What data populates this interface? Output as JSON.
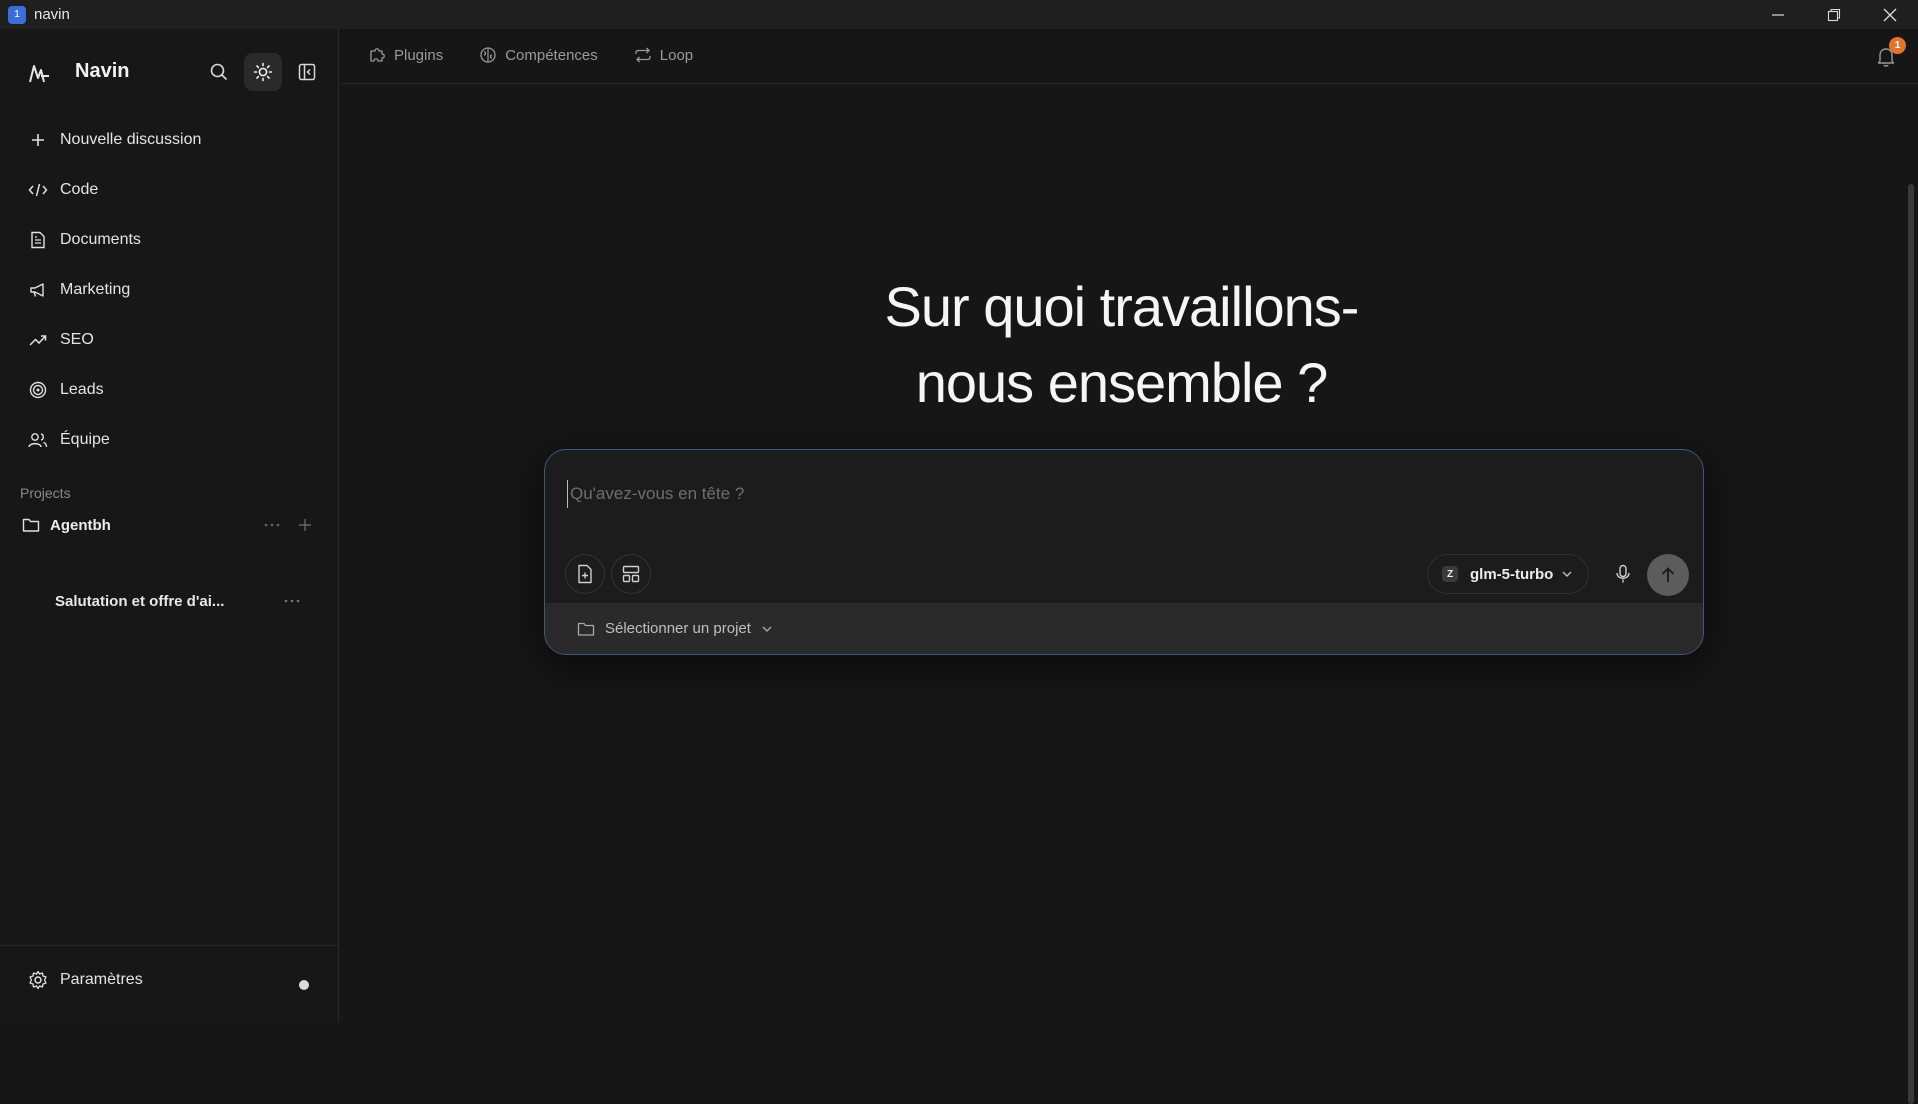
{
  "window": {
    "app_icon_glyph": "1",
    "title": "navin"
  },
  "sidebar": {
    "brand_name": "Navin",
    "nav_items": [
      {
        "label": "Nouvelle discussion",
        "icon": "plus-icon"
      },
      {
        "label": "Code",
        "icon": "code-icon"
      },
      {
        "label": "Documents",
        "icon": "document-icon"
      },
      {
        "label": "Marketing",
        "icon": "megaphone-icon"
      },
      {
        "label": "SEO",
        "icon": "trending-up-icon"
      },
      {
        "label": "Leads",
        "icon": "target-icon"
      },
      {
        "label": "Équipe",
        "icon": "users-icon"
      }
    ],
    "projects_label": "Projects",
    "project_name": "Agentbh",
    "chat_title": "Salutation et offre d'ai...",
    "settings_label": "Paramètres"
  },
  "topnav": {
    "tabs": [
      {
        "label": "Plugins",
        "icon": "puzzle-icon"
      },
      {
        "label": "Compétences",
        "icon": "brain-icon"
      },
      {
        "label": "Loop",
        "icon": "repeat-icon"
      }
    ],
    "notification_count": "1"
  },
  "main": {
    "hero_line1": "Sur quoi travaillons-",
    "hero_line2": "nous ensemble ?",
    "composer": {
      "placeholder": "Qu'avez-vous en tête ?",
      "value": "",
      "model_badge": "Z",
      "model_name": "glm-5-turbo",
      "project_select_label": "Sélectionner un projet"
    }
  },
  "colors": {
    "accent_badge": "#e0742e",
    "composer_border": "#3f5876",
    "background": "#161616"
  }
}
